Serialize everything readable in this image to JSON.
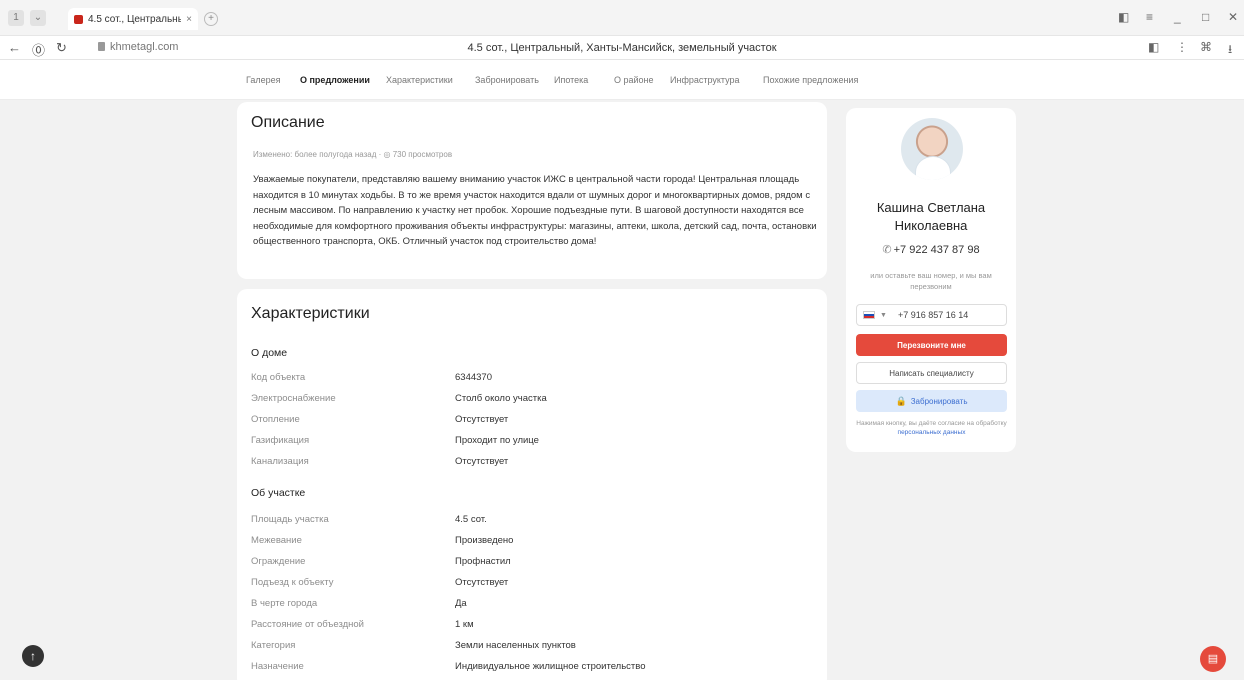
{
  "browser": {
    "tab_title": "4.5 сот., Центральный, X",
    "tab_close": "×",
    "new_tab": "+",
    "url": "khmetagl.com",
    "page_title": "4.5 сот., Центральный, Ханты-Мансийск, земельный участок",
    "back": "←",
    "forward_shield": "⓪",
    "reload": "↻",
    "minimize": "_",
    "maximize": "□",
    "close": "✕",
    "menu": "≡",
    "bookmark": "◧",
    "more": "⋮",
    "extensions": "⌘",
    "download": "⭳",
    "left_btn_1": "1",
    "left_btn_2": "⌄"
  },
  "sitenav": {
    "items": [
      {
        "label": "Галерея"
      },
      {
        "label": "О предложении"
      },
      {
        "label": "Характеристики"
      },
      {
        "label": "Забронировать"
      },
      {
        "label": "Ипотека"
      },
      {
        "label": "О районе"
      },
      {
        "label": "Инфраструктура"
      },
      {
        "label": "Похожие предложения"
      }
    ]
  },
  "description": {
    "title": "Описание",
    "meta": "Изменено: более полугода назад  ·  ◎ 730 просмотров",
    "text": "Уважаемые покупатели, представляю вашему вниманию участок ИЖС в центральной части города! Центральная площадь находится в 10 минутах ходьбы. В то же время участок находится вдали от шумных дорог и многоквартирных домов, рядом с лесным массивом. По направлению к участку нет пробок. Хорошие подъездные пути. В шаговой доступности находятся все необходимые для комфортного проживания объекты инфраструктуры: магазины, аптеки, школа, детский сад, почта, остановки общественного транспорта, ОКБ. Отличный участок под строительство дома!"
  },
  "characteristics": {
    "title": "Характеристики",
    "sections": [
      {
        "title": "О доме",
        "rows": [
          {
            "label": "Код объекта",
            "value": "6344370"
          },
          {
            "label": "Электроснабжение",
            "value": "Столб около участка"
          },
          {
            "label": "Отопление",
            "value": "Отсутствует"
          },
          {
            "label": "Газификация",
            "value": "Проходит по улице"
          },
          {
            "label": "Канализация",
            "value": "Отсутствует"
          }
        ]
      },
      {
        "title": "Об участке",
        "rows": [
          {
            "label": "Площадь участка",
            "value": "4.5 сот."
          },
          {
            "label": "Межевание",
            "value": "Произведено"
          },
          {
            "label": "Ограждение",
            "value": "Профнастил"
          },
          {
            "label": "Подъезд к объекту",
            "value": "Отсутствует"
          },
          {
            "label": "В черте города",
            "value": "Да"
          },
          {
            "label": "Расстояние от объездной",
            "value": "1 км"
          },
          {
            "label": "Категория",
            "value": "Земли населенных пунктов"
          },
          {
            "label": "Назначение",
            "value": "Индивидуальное жилищное строительство"
          }
        ]
      }
    ]
  },
  "agent": {
    "name_line1": "Кашина Светлана",
    "name_line2": "Николаевна",
    "phone_icon": "✆",
    "phone": "+7 922 437 87 98",
    "callback_hint": "или оставьте ваш номер, и мы вам перезвоним",
    "input_chevron": "▼",
    "input_value": "+7 916 857 16 14",
    "call_me_label": "Перезвоните мне",
    "write_label": "Написать специалисту",
    "book_icon": "🔒",
    "book_label": "Забронировать",
    "consent_text": "Нажимая кнопку, вы даёте согласие на обработку ",
    "consent_link": "персональных данных"
  },
  "floating": {
    "scroll_up": "↑",
    "chat": "▤"
  }
}
